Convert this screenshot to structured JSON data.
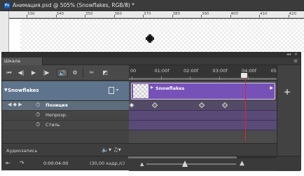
{
  "document": {
    "app_badge": "Ps",
    "title": "Анимация.psd @ 505% (Snowflakes, RGB/8) *",
    "close_symbol": "×",
    "ruler_labels": [
      "330",
      "340",
      "350",
      "360",
      "370",
      "380",
      "390",
      "400",
      "410",
      "420"
    ]
  },
  "timeline": {
    "tab_label": "Шкала времени",
    "panel_collapse": "◂◂",
    "panel_close": "×",
    "panel_menu": "≡",
    "controls": {
      "first_frame": "⏮",
      "prev_frame": "◀|",
      "play": "▶",
      "next_frame": "|▶",
      "sound": "🔊",
      "settings": "⚙",
      "split": "✂",
      "transition": "◩"
    },
    "ruler_labels": [
      "00",
      "01:00f",
      "02:00f",
      "03:00f",
      "04:00f",
      "05:0"
    ],
    "layer": {
      "name": "Snowflakes",
      "arrow": "▼",
      "dropdown": "▾"
    },
    "clip": {
      "name": "Snowflakes",
      "arrow": "▶",
      "end": "▶"
    },
    "properties": [
      {
        "label": "Позиция",
        "nav": "◀ ◆ ▶",
        "selected": true
      },
      {
        "label": "Непрозр.",
        "nav": "",
        "selected": false
      },
      {
        "label": "Стиль",
        "nav": "",
        "selected": false
      }
    ],
    "stopwatch": "⏱",
    "keyframes_position": [
      0.0,
      0.2,
      0.6,
      0.8
    ],
    "audio": {
      "label": "Аудиозапись",
      "icons": "🔈▾ ♫▾"
    },
    "add_symbol": "+",
    "playhead_time_fraction": 0.8
  },
  "status": {
    "render_icon": "⇤",
    "loop_icon": "↷",
    "current_time": "0:00:04:00",
    "fps": "(30,00 кадр./с)",
    "zoom_out": "▲",
    "zoom_in": "▲",
    "zoom_level": 0.4
  }
}
